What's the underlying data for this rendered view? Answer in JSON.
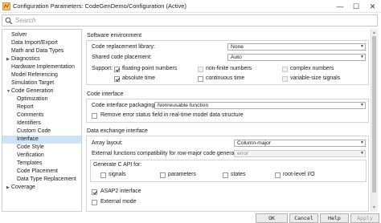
{
  "window": {
    "title": "Configuration Parameters: CodeGenDemo/Configuration (Active)",
    "minimize_glyph": "—",
    "maximize_glyph": "☐",
    "close_glyph": "✕"
  },
  "search": {
    "placeholder": "Search",
    "value": ""
  },
  "tree": {
    "items": [
      {
        "label": "Solver",
        "expandable": false
      },
      {
        "label": "Data Import/Export",
        "expandable": false
      },
      {
        "label": "Math and Data Types",
        "expandable": false
      },
      {
        "label": "Diagnostics",
        "expandable": true,
        "expanded": false
      },
      {
        "label": "Hardware Implementation",
        "expandable": false
      },
      {
        "label": "Model Referencing",
        "expandable": false
      },
      {
        "label": "Simulation Target",
        "expandable": false
      },
      {
        "label": "Code Generation",
        "expandable": true,
        "expanded": true
      },
      {
        "label": "Optimization",
        "expandable": false
      },
      {
        "label": "Report",
        "expandable": false
      },
      {
        "label": "Comments",
        "expandable": false
      },
      {
        "label": "Identifiers",
        "expandable": false
      },
      {
        "label": "Custom Code",
        "expandable": false
      },
      {
        "label": "Interface",
        "expandable": false,
        "selected": true
      },
      {
        "label": "Code Style",
        "expandable": false
      },
      {
        "label": "Verification",
        "expandable": false
      },
      {
        "label": "Templates",
        "expandable": false
      },
      {
        "label": "Code Placement",
        "expandable": false
      },
      {
        "label": "Data Type Replacement",
        "expandable": false
      },
      {
        "label": "Coverage",
        "expandable": true,
        "expanded": false
      }
    ],
    "arrow_collapsed": "▶",
    "arrow_expanded": "▼"
  },
  "software_environment": {
    "heading": "Software environment",
    "code_replacement_library": {
      "label": "Code replacement library:",
      "value": "None"
    },
    "shared_code_placement": {
      "label": "Shared code placement:",
      "value": "Auto"
    },
    "support": {
      "label": "Support:",
      "options": [
        {
          "label": "floating-point numbers",
          "checked": true,
          "enabled": true
        },
        {
          "label": "non-finite numbers",
          "checked": false,
          "enabled": false
        },
        {
          "label": "complex numbers",
          "checked": false,
          "enabled": false
        },
        {
          "label": "absolute time",
          "checked": true,
          "enabled": true
        },
        {
          "label": "continuous time",
          "checked": false,
          "enabled": true
        },
        {
          "label": "variable-size signals",
          "checked": false,
          "enabled": false
        }
      ]
    }
  },
  "code_interface": {
    "heading": "Code interface",
    "packaging": {
      "label": "Code interface packaging:",
      "value": "Nonreusable function"
    },
    "remove_error_status": {
      "label": "Remove error status field in real-time model data structure",
      "checked": false
    }
  },
  "data_exchange": {
    "heading": "Data exchange interface",
    "array_layout": {
      "label": "Array layout:",
      "value": "Column-major"
    },
    "external_functions": {
      "label": "External functions compatibility for row-major code generation:",
      "value": "error"
    },
    "generate_c_api": {
      "label": "Generate C API for:",
      "options": [
        {
          "label": "signals",
          "checked": false
        },
        {
          "label": "parameters",
          "checked": false
        },
        {
          "label": "states",
          "checked": false
        },
        {
          "label": "root-level I/O",
          "checked": false
        }
      ]
    },
    "asap2": {
      "label": "ASAP2 interface",
      "checked": true
    },
    "external_mode": {
      "label": "External mode",
      "checked": false
    }
  },
  "buttons": {
    "ok": "OK",
    "cancel": "Cancel",
    "help": "Help",
    "apply": "Apply"
  },
  "colors": {
    "selection": "#cfe3f6",
    "app_icon": "#e8a33c"
  }
}
